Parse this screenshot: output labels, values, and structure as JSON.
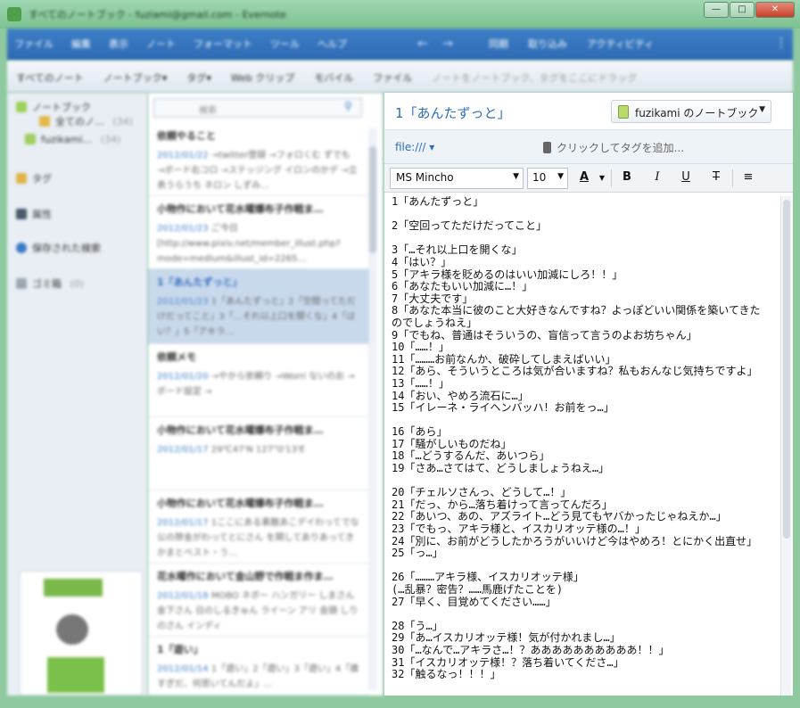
{
  "window": {
    "title": "すべてのノートブック - fuziami@gmail.com - Evernote",
    "buttons": [
      "—",
      "□",
      "✕"
    ]
  },
  "menu": {
    "items": [
      "ファイル",
      "編集",
      "表示",
      "ノート",
      "フォーマット",
      "ツール",
      "ヘルプ"
    ],
    "nav": [
      "←",
      "→"
    ],
    "tools": [
      "同期",
      "取り込み",
      "アクティビティ"
    ]
  },
  "toolbar2": {
    "items": [
      "すべてのノート",
      "ノートブック▾",
      "タグ▾",
      "Web クリップ",
      "モバイル",
      "ファイル"
    ],
    "drop_hint": "ノートをノートブック、タグをここにドラッグ"
  },
  "sidebar": {
    "rows": [
      {
        "label": "ノートブック"
      },
      {
        "label": "全てのノ…",
        "count": "(34)"
      },
      {
        "label": "fuzikami…",
        "count": "(34)"
      },
      {
        "label": "タグ"
      },
      {
        "label": "属性"
      },
      {
        "label": "保存された検索"
      },
      {
        "label": "ゴミ箱",
        "count": "(0)"
      }
    ]
  },
  "notelist": {
    "search_placeholder": "検索",
    "notes": [
      {
        "title": "依頼やること",
        "date": "2012/01/22",
        "snippet": "→twitter登録 →フォロくむ ずでも →ボード右コロ →ステッジング イロンのかデ →立表うらうち ネロン しずみ…"
      },
      {
        "title": "小物作において花水曜爆布子作戦ま…",
        "date": "2012/01/23",
        "snippet": "ご今日 [http://www.pixiv.net/member_illust.php?mode=medium&illust_id=2265…"
      },
      {
        "title": "1「あんたずっと」",
        "date": "2012/01/23",
        "snippet": "1「あんたずっと」2「空間ってただけだってこと」3「…それ以上口を開くな」4「はい？」5「アキラ…"
      },
      {
        "title": "依頼メモ",
        "date": "2012/01/20",
        "snippet": "→やから依頼り →Worri ないのお →ボード設定 →"
      },
      {
        "title": "小物作において花水曜爆布子作戦ま…",
        "date": "2012/01/17",
        "snippet": "29℃47'N 127°0'13'E"
      },
      {
        "title": "小物作において花水曜爆布子作戦ま…",
        "date": "2012/01/17",
        "snippet": "1ここにある素敵あこデイわってでな 公の弊金がわってとにさん を関してありあってきかまとベスト・う…"
      },
      {
        "title": "花水曜作において金山野で作戦ま作ま…",
        "date": "2012/01/18",
        "snippet": "MOBO ネボー ハンガリー しまさん 金下さん 日のしるきゅん ライーン アリ 会頭 しりのさん インディ"
      },
      {
        "title": "1「遊い」",
        "date": "2012/01/14",
        "snippet": "1「遊い」2「遊い」3「遊い」4「誰すぎだ、何思いてんだよ」…"
      }
    ]
  },
  "editor": {
    "note_title": "1「あんたずっと」",
    "notebook": "fuzikami のノートブック",
    "source_link": "file:/// ▾",
    "tag_hint": "クリックしてタグを追加...",
    "font": "MS Mincho",
    "size": "10",
    "format_buttons": [
      "A",
      "B",
      "I",
      "U",
      "T",
      "≡"
    ],
    "body": "1「あんたずっと」\n\n2「空回ってただけだってこと」\n\n3「…それ以上口を開くな」\n4「はい？」\n5「アキラ様を貶めるのはいい加減にしろ！！」\n6「あなたもいい加減に…！」\n7「大丈夫です」\n8「あなた本当に彼のこと大好きなんですね？よっぽどいい関係を築いてきたのでしょうねえ」\n9「でもね、普通はそういうの、盲信って言うのよお坊ちゃん」\n10「……！」\n11「………お前なんか、破砕してしまえばいい」\n12「あら、そういうところは気が合いますね？私もおんなじ気持ちですよ」\n13「……！」\n14「おい、やめろ流石に…」\n15「イレーネ・ライヘンバッハ！お前をっ…」\n\n16「あら」\n17「騒がしいものだね」\n18「…どうするんだ、あいつら」\n19「さあ…さてはて、どうしましょうねえ…」\n\n20「チェルソさんっ、どうして…！」\n21「だっ、から…落ち着けって言ってんだろ」\n22「あいつ、あの、アズライト…どう見てもヤバかったじゃねえか…」\n23「でもっ、アキラ様と、イスカリオッテ様の…！」\n24「別に、お前がどうしたかろうがいいけど今はやめろ！とにかく出直せ」\n25「っ…」\n\n26「………アキラ様、イスカリオッテ様」\n(…乱暴？密告？……馬鹿げたことを)\n27「早く、目覚めてください……」\n\n28「う…」\n29「あ…イスカリオッテ様！気が付かれまし…」\n30「…なんで…アキラさ…！？ああああああああああ！！」\n31「イスカリオッテ様！？落ち着いてくださ…」\n32「触るなっ！！！」"
  }
}
